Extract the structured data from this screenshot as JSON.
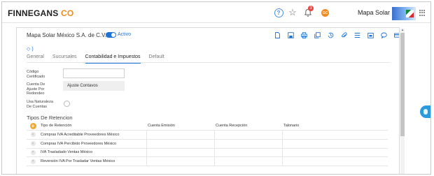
{
  "app": {
    "logo_main": "FINNEGANS",
    "logo_suffix": "CO",
    "company_name": "Mapa Solar",
    "notification_count": "3",
    "user_initials": "GC"
  },
  "record": {
    "title": "Mapa Solar México S.A. de C.V.",
    "status": "Activo",
    "breadcrumb": "◇ )"
  },
  "toolbar": {
    "icons": [
      "document-icon",
      "save-icon",
      "print-icon",
      "copy-icon",
      "history-icon",
      "attach-icon",
      "list-icon",
      "calendar-icon",
      "comment-icon",
      "card-icon",
      "close-icon"
    ]
  },
  "tabs": [
    {
      "label": "General",
      "active": false
    },
    {
      "label": "Sucursales",
      "active": false
    },
    {
      "label": "Contabilidad e Impuestos",
      "active": true
    },
    {
      "label": "Default",
      "active": false
    }
  ],
  "fields": {
    "codigo_label": "Código Certificado",
    "codigo_value": "",
    "cuenta_label": "Cuenta De Ajuste Por Redondeo",
    "cuenta_value": "Ajuste Contavos",
    "naturaleza_label": "Usa Naturaleza De Cuentas"
  },
  "retenciones": {
    "title": "Tipos De Retencion",
    "columns": {
      "retencion": "Tipo de Retención",
      "emision": "Cuenta Emisión",
      "recepcion": "Cuenta Recepción",
      "talonario": "Talonario"
    },
    "rows": [
      {
        "retencion": "Compras IVA Acreditable Proveedores México",
        "emision": "",
        "recepcion": "",
        "talonario": ""
      },
      {
        "retencion": "Compras IVA Percibido Proveedores México",
        "emision": "",
        "recepcion": "",
        "talonario": ""
      },
      {
        "retencion": "IVA Trasladado Ventas México",
        "emision": "",
        "recepcion": "",
        "talonario": ""
      },
      {
        "retencion": "Reversión IVA Por Trasladar Ventas México",
        "emision": "",
        "recepcion": "",
        "talonario": ""
      }
    ]
  },
  "colors": {
    "accent": "#1c73d6",
    "logo_accent": "#f28a1c",
    "add_button": "#f0a830",
    "badge": "#e8453c"
  }
}
